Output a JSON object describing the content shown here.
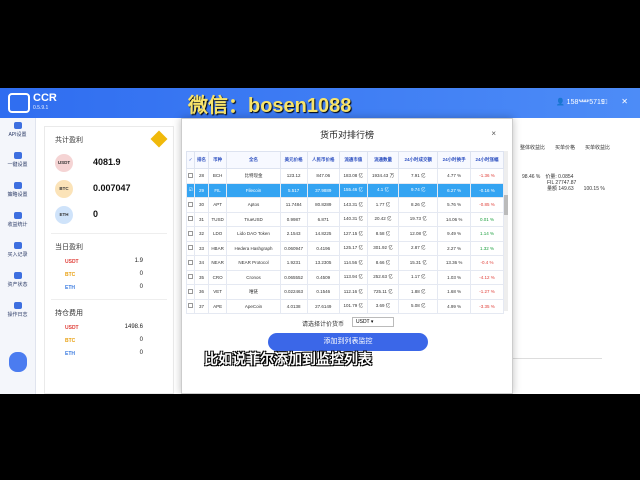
{
  "app": {
    "brand": "CCR",
    "version": "0.5.9.1",
    "user": "158****5719",
    "window_controls": "— □ ✕"
  },
  "watermark": "微信：bosen1088",
  "sidebar": [
    {
      "label": "API设置",
      "icon": "api-icon"
    },
    {
      "label": "一键设置",
      "icon": "setup-icon"
    },
    {
      "label": "策略设置",
      "icon": "strategy-icon"
    },
    {
      "label": "收益统计",
      "icon": "stats-icon"
    },
    {
      "label": "买入记录",
      "icon": "buy-record-icon"
    },
    {
      "label": "资产状态",
      "icon": "asset-icon"
    },
    {
      "label": "操作日志",
      "icon": "log-icon"
    }
  ],
  "panel": {
    "total_title": "共计盈利",
    "total": [
      {
        "coin": "USDT",
        "value": "4081.9",
        "color": "#f5d4d4"
      },
      {
        "coin": "BTC",
        "value": "0.007047",
        "color": "#fbe3b8"
      },
      {
        "coin": "ETH",
        "value": "0",
        "color": "#cfe3fa"
      }
    ],
    "today_title": "当日盈利",
    "today": [
      {
        "coin": "USDT",
        "value": "1.9"
      },
      {
        "coin": "BTC",
        "value": "0"
      },
      {
        "coin": "ETH",
        "value": "0"
      }
    ],
    "fee_title": "持仓费用",
    "fee": [
      {
        "coin": "USDT",
        "value": "1498.6"
      },
      {
        "coin": "BTC",
        "value": "0"
      },
      {
        "coin": "ETH",
        "value": "0"
      }
    ]
  },
  "right": {
    "headers": "整体收益比　　买单价格　　买单收益比",
    "data": "98.46 %　价量: 0.0854\n　　　　　FIL 27747.87\n　　　　　量额 149.63　　100.15 %"
  },
  "modal": {
    "title": "货币对排行榜",
    "close": "×",
    "columns": [
      "✓",
      "排名",
      "币种",
      "全名",
      "美元价格",
      "人民币价格",
      "流通市值",
      "流通数量",
      "24小时成交额",
      "24小时换手",
      "24小时涨幅"
    ],
    "rows": [
      [
        "",
        "28",
        "BCH",
        "比特现金",
        "123.12",
        "847.06",
        "183.08 亿",
        "1934.43 万",
        "7.91 亿",
        "4.77 %",
        "-1.36 %"
      ],
      [
        "☑",
        "29",
        "FIL",
        "Filecoin",
        "5.517",
        "37.9889",
        "155.46 亿",
        "4.1 亿",
        "9.74 亿",
        "6.27 %",
        "-0.16 %"
      ],
      [
        "",
        "30",
        "APT",
        "Aptos",
        "11.7484",
        "80.8289",
        "143.31 亿",
        "1.77 亿",
        "8.26 亿",
        "5.76 %",
        "-0.85 %"
      ],
      [
        "",
        "31",
        "TUSD",
        "TrueUSD",
        "0.9987",
        "6.871",
        "140.31 亿",
        "20.42 亿",
        "19.73 亿",
        "14.06 %",
        "0.01 %"
      ],
      [
        "",
        "32",
        "LDO",
        "Lido DAO Token",
        "2.1543",
        "14.8225",
        "127.15 亿",
        "8.58 亿",
        "12.08 亿",
        "9.49 %",
        "1.14 %"
      ],
      [
        "",
        "33",
        "HBAR",
        "Hedera Hashgraph",
        "0.060947",
        "0.4196",
        "125.17 亿",
        "301.92 亿",
        "2.87 亿",
        "2.27 %",
        "1.32 %"
      ],
      [
        "",
        "34",
        "NEAR",
        "NEAR Protocol",
        "1.9231",
        "13.2305",
        "114.56 亿",
        "8.66 亿",
        "15.31 亿",
        "13.36 %",
        "-0.4 %"
      ],
      [
        "",
        "35",
        "CRO",
        "Cronos",
        "0.065552",
        "0.4509",
        "113.94 亿",
        "252.63 亿",
        "1.17 亿",
        "1.03 %",
        "-4.12 %"
      ],
      [
        "",
        "36",
        "VET",
        "唯链",
        "0.022463",
        "0.1546",
        "112.16 亿",
        "725.11 亿",
        "1.88 亿",
        "1.68 %",
        "-1.27 %"
      ],
      [
        "",
        "37",
        "APE",
        "ApeCoin",
        "4.0138",
        "27.6149",
        "101.79 亿",
        "3.69 亿",
        "5.08 亿",
        "4.99 %",
        "-3.35 %"
      ]
    ],
    "sort_label": "请选择计价货币",
    "sort_value": "USDT",
    "add_button": "添加到列表监控"
  },
  "subtitle": "比如说菲尔添加到监控列表"
}
